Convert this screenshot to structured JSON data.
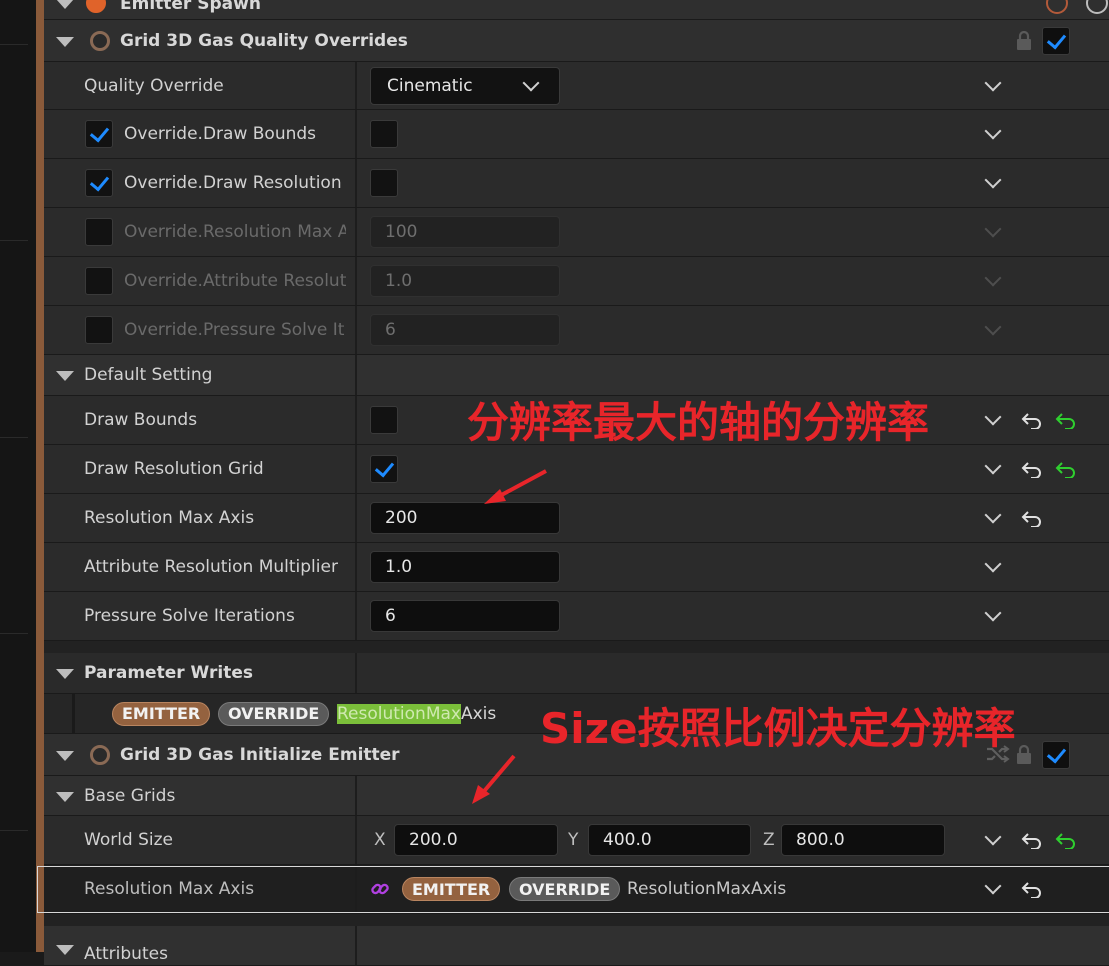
{
  "emitter_spawn": {
    "title": "Emitter Spawn"
  },
  "quality_section": {
    "title": "Grid 3D Gas Quality Overrides",
    "rows": [
      {
        "label": "Quality Override",
        "value": "Cinematic"
      },
      {
        "label": "Override.Draw Bounds"
      },
      {
        "label": "Override.Draw Resolution"
      },
      {
        "label": "Override.Resolution Max A",
        "value": "100"
      },
      {
        "label": "Override.Attribute Resolut",
        "value": "1.0"
      },
      {
        "label": "Override.Pressure Solve It",
        "value": "6"
      }
    ]
  },
  "default_setting": {
    "title": "Default Setting",
    "rows": [
      {
        "label": "Draw Bounds"
      },
      {
        "label": "Draw Resolution Grid"
      },
      {
        "label": "Resolution Max Axis",
        "value": "200"
      },
      {
        "label": "Attribute Resolution Multiplier",
        "value": "1.0"
      },
      {
        "label": "Pressure Solve Iterations",
        "value": "6"
      }
    ]
  },
  "parameter_writes": {
    "title": "Parameter Writes",
    "emitter_tag": "EMITTER",
    "override_tag": "OVERRIDE",
    "param_highlight": "ResolutionMax",
    "param_rest": "Axis"
  },
  "initialize_section": {
    "title": "Grid 3D Gas Initialize Emitter",
    "category": "Base Grids",
    "world_size_label": "World Size",
    "x_label": "X",
    "x_value": "200.0",
    "y_label": "Y",
    "y_value": "400.0",
    "z_label": "Z",
    "z_value": "800.0",
    "res_label": "Resolution Max Axis",
    "res_emitter_tag": "EMITTER",
    "res_override_tag": "OVERRIDE",
    "res_param": "ResolutionMaxAxis",
    "attributes_title": "Attributes"
  },
  "annotations": {
    "note1": "分辨率最大的轴的分辨率",
    "note2": "Size按照比例决定分辨率"
  },
  "colors": {
    "accent": "#8a5a3a",
    "checkbox_blue": "#1e8bff",
    "reset_green": "#2fd02f",
    "annotation_red": "#e8252a",
    "highlight_green": "#7bbf3a"
  },
  "icons": [
    "caret-down-icon",
    "module-ring-icon",
    "lock-icon",
    "checkmark-icon",
    "chevron-down-icon",
    "reset-arrow-icon",
    "link-icon",
    "shuffle-icon",
    "info-icon"
  ]
}
